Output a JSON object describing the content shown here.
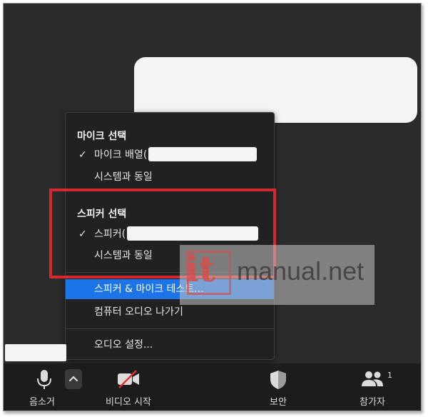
{
  "menu": {
    "mic_heading": "마이크 선택",
    "mic_items": [
      {
        "label": "마이크 배열(",
        "checked": true
      },
      {
        "label": "시스템과 동일",
        "checked": false
      }
    ],
    "speaker_heading": "스피커 선택",
    "speaker_items": [
      {
        "label": "스피커(",
        "checked": true
      },
      {
        "label": "시스템과 동일",
        "checked": false
      }
    ],
    "test_label": "스피커 & 마이크 테스트...",
    "leave_audio_label": "컴퓨터 오디오 나가기",
    "settings_label": "오디오 설정...",
    "check_glyph": "✓"
  },
  "toolbar": {
    "mute_label": "음소거",
    "video_label": "비디오 시작",
    "security_label": "보안",
    "participants_label": "참가자",
    "participants_count": "1"
  },
  "watermark": {
    "logo_text": "it",
    "site_text": "manual.net"
  },
  "colors": {
    "highlight": "#1d73e8",
    "annotation_red": "#d42a2f",
    "background": "#2b2b2b",
    "toolbar": "#1c1c1c"
  },
  "icons": {
    "mic": "microphone-icon",
    "chevron": "chevron-up-icon",
    "video": "video-off-icon",
    "security": "shield-icon",
    "participants": "participants-icon",
    "check": "checkmark-icon"
  }
}
